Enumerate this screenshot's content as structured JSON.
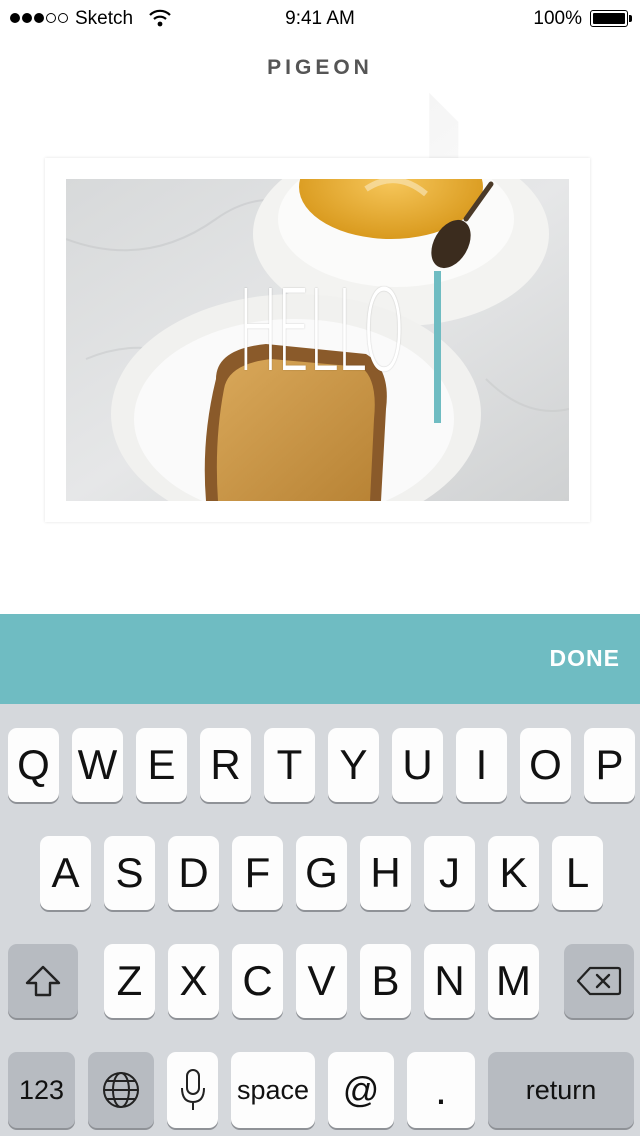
{
  "status_bar": {
    "carrier": "Sketch",
    "time": "9:41 AM",
    "battery": "100%",
    "signal_bars_filled": 3,
    "signal_bars_total": 5
  },
  "app": {
    "title": "PIGEON"
  },
  "card": {
    "overlay_text": "HELLO"
  },
  "toolbar": {
    "done_label": "DONE",
    "accent_color": "#6fbcc2"
  },
  "keyboard": {
    "row1": [
      "Q",
      "W",
      "E",
      "R",
      "T",
      "Y",
      "U",
      "I",
      "O",
      "P"
    ],
    "row2": [
      "A",
      "S",
      "D",
      "F",
      "G",
      "H",
      "J",
      "K",
      "L"
    ],
    "row3": [
      "Z",
      "X",
      "C",
      "V",
      "B",
      "N",
      "M"
    ],
    "bottom": {
      "numbers": "123",
      "space": "space",
      "at": "@",
      "period": ".",
      "return": "return"
    },
    "icons": {
      "shift": "shift-icon",
      "delete": "delete-icon",
      "globe": "globe-icon",
      "mic": "mic-icon"
    }
  }
}
